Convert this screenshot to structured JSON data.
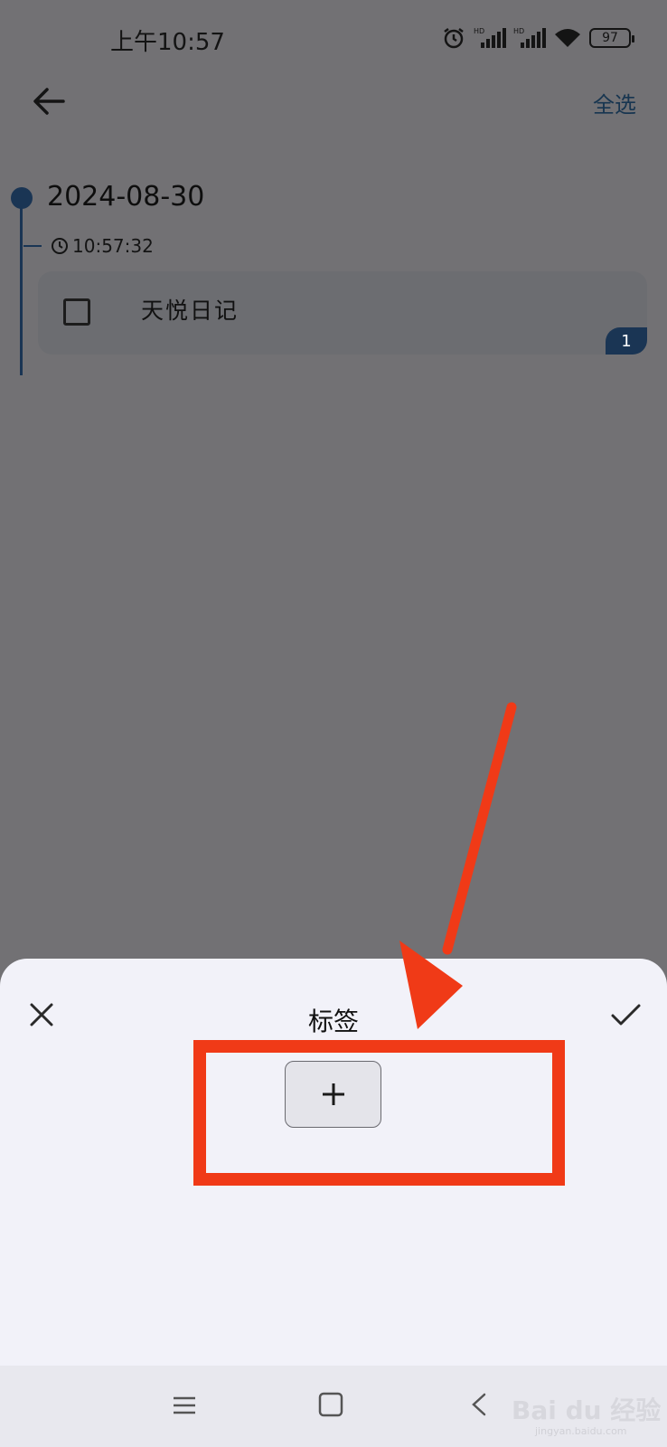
{
  "status_bar": {
    "time": "上午10:57",
    "battery": "97",
    "icons": [
      "alarm-icon",
      "signal-hd-icon",
      "signal-hd-icon",
      "wifi-icon",
      "battery-icon"
    ]
  },
  "header": {
    "back_icon": "arrow-left-icon",
    "select_all": "全选"
  },
  "timeline": {
    "date": "2024-08-30",
    "time": "10:57:32",
    "entries": [
      {
        "title": "天悦日记",
        "count": "1"
      }
    ]
  },
  "sheet": {
    "title": "标签",
    "close_icon": "close-icon",
    "confirm_icon": "check-icon",
    "add_icon": "plus-icon"
  },
  "watermark": {
    "brand": "Bai du 经验",
    "url": "jingyan.baidu.com"
  },
  "colors": {
    "overlay": "#727174",
    "accent": "#1a3554",
    "highlight": "#f03a17",
    "sheet": "#f2f2f9"
  }
}
